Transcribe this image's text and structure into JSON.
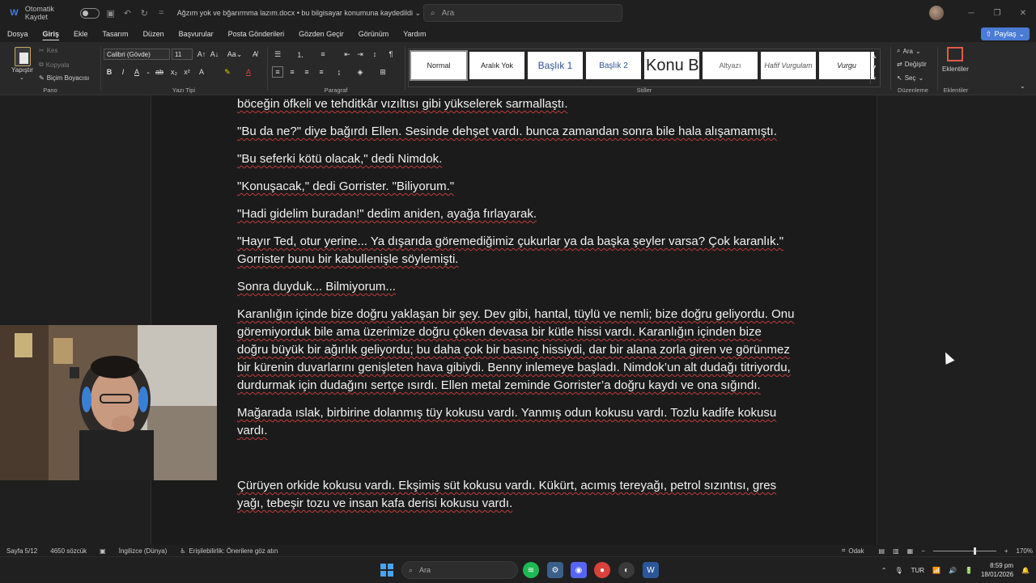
{
  "titlebar": {
    "autosave_label": "Otomatik Kaydet",
    "doc_title": "Ağzım yok  ve bğarırmma lazım.docx  •  bu bilgisayar konumuna kaydedildi  ⌄",
    "search_placeholder": "Ara"
  },
  "menu": {
    "items": [
      "Dosya",
      "Giriş",
      "Ekle",
      "Tasarım",
      "Düzen",
      "Başvurular",
      "Posta Gönderileri",
      "Gözden Geçir",
      "Görünüm",
      "Yardım"
    ],
    "share_label": "Paylaş"
  },
  "ribbon": {
    "clipboard": {
      "paste": "Yapıştır",
      "cut": "Kes",
      "copy": "Kopyala",
      "format_painter": "Biçim Boyacısı",
      "label": "Pano"
    },
    "font": {
      "family": "Calibri (Gövde)",
      "size": "11",
      "label": "Yazı Tipi"
    },
    "paragraph": {
      "label": "Paragraf"
    },
    "styles": {
      "label": "Stiller",
      "items": [
        "Normal",
        "Aralık Yok",
        "Başlık 1",
        "Başlık 2",
        "Konu B",
        "Altyazı",
        "Hafif Vurgulam",
        "Vurgu"
      ]
    },
    "editing": {
      "find": "Ara",
      "replace": "Değiştir",
      "select": "Seç",
      "label": "Düzenleme"
    },
    "addins": {
      "button": "Eklentiler",
      "label": "Eklentiler"
    }
  },
  "document": {
    "paragraphs": [
      "böceğin öfkeli ve tehditkâr vızıltısı gibi yükselerek sarmallaştı.",
      "\"Bu da ne?\" diye bağırdı Ellen. Sesinde dehşet vardı. bunca zamandan sonra bile hala alışamamıştı.",
      "\"Bu seferki kötü olacak,\" dedi Nimdok.",
      "\"Konuşacak,\" dedi Gorrister. \"Biliyorum.\"",
      "\"Hadi gidelim buradan!\" dedim aniden, ayağa fırlayarak.",
      "\"Hayır Ted, otur yerine... Ya dışarıda göremediğimiz çukurlar ya da başka şeyler varsa? Çok karanlık.\" Gorrister bunu bir kabullenişle söylemişti.",
      "Sonra duyduk... Bilmiyorum...",
      "Karanlığın içinde bize doğru yaklaşan bir şey. Dev gibi, hantal, tüylü ve nemli; bize doğru geliyordu. Onu göremiyorduk bile ama üzerimize doğru çöken devasa bir kütle hissi vardı. Karanlığın içinden bize doğru büyük bir ağırlık geliyordu; bu daha çok bir basınç hissiydi, dar bir alana zorla giren ve görünmez bir kürenin duvarlarını genişleten hava gibiydi. Benny inlemeye başladı. Nimdok’un alt dudağı titriyordu, durdurmak için dudağını sertçe ısırdı. Ellen metal zeminde Gorrister’a doğru kaydı ve ona sığındı.",
      "Mağarada ıslak, birbirine dolanmış tüy kokusu vardı. Yanmış odun kokusu vardı. Tozlu kadife kokusu vardı.",
      "Çürüyen orkide kokusu vardı. Ekşimiş süt kokusu vardı. Kükürt, acımış tereyağı, petrol sızıntısı, gres yağı, tebeşir tozu ve insan kafa derisi kokusu vardı."
    ]
  },
  "statusbar": {
    "page": "Sayfa 5/12",
    "words": "4650 sözcük",
    "language": "İngilizce (Dünya)",
    "accessibility": "Erişilebilirlik: Önerilere göz atın",
    "focus": "Odak",
    "zoom": "170%",
    "zoom_fraction": 0.64
  },
  "taskbar": {
    "search_placeholder": "Ara",
    "lang": "TUR",
    "time": "8:59 pm",
    "date": "18/01/2026"
  }
}
